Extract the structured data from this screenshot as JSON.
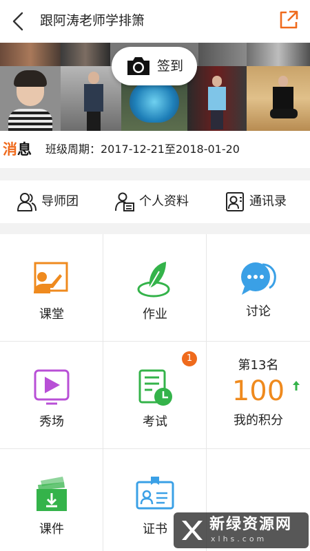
{
  "header": {
    "title": "跟阿涛老师学排箫",
    "back_icon": "back-chevron-icon",
    "share_icon": "share-external-icon",
    "accent": "#ef6a1c"
  },
  "banner": {
    "checkin_label": "签到",
    "camera_icon": "camera-icon"
  },
  "message": {
    "icon_text_first": "消",
    "icon_text_rest": "息",
    "period": "班级周期：2017-12-21至2018-01-20"
  },
  "tabs": [
    {
      "label": "导师团",
      "icon": "mentor-group-icon"
    },
    {
      "label": "个人资料",
      "icon": "profile-card-icon"
    },
    {
      "label": "通讯录",
      "icon": "contacts-icon"
    }
  ],
  "grid": {
    "classroom": {
      "label": "课堂",
      "icon": "classroom-icon"
    },
    "homework": {
      "label": "作业",
      "icon": "feather-pen-icon"
    },
    "discussion": {
      "label": "讨论",
      "icon": "chat-bubble-icon"
    },
    "showcase": {
      "label": "秀场",
      "icon": "play-icon"
    },
    "exam": {
      "label": "考试",
      "icon": "exam-clock-icon",
      "badge": "1"
    },
    "points": {
      "rank": "第13名",
      "score": "100",
      "label": "我的积分",
      "trend_icon": "arrow-up-icon"
    },
    "courseware": {
      "label": "课件",
      "icon": "download-box-icon"
    },
    "certificate": {
      "label": "证书",
      "icon": "certificate-icon"
    }
  },
  "watermark": {
    "name": "新绿资源网",
    "url": "xlhs.com"
  },
  "colors": {
    "orange": "#ef8a1e",
    "green": "#34b34a",
    "blue": "#3aa0e6",
    "purple": "#b84fd6"
  }
}
